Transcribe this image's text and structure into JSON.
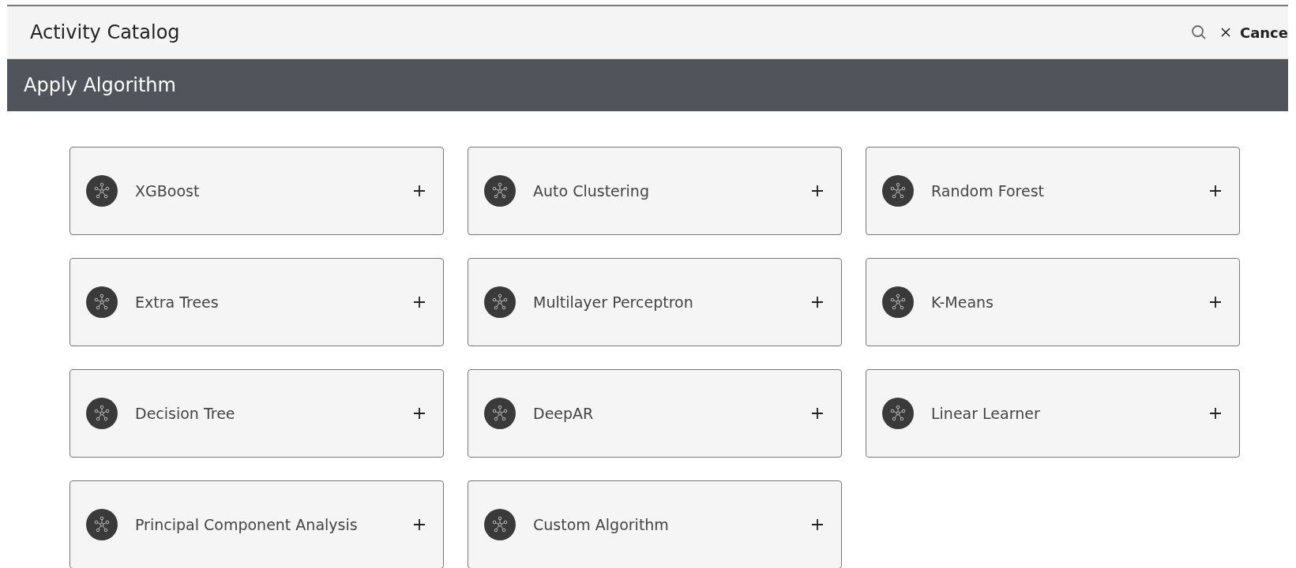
{
  "header": {
    "title": "Activity Catalog",
    "cancel_label": "Cance"
  },
  "section": {
    "title": "Apply Algorithm"
  },
  "cards": [
    {
      "label": "XGBoost"
    },
    {
      "label": "Auto Clustering"
    },
    {
      "label": "Random Forest"
    },
    {
      "label": "Extra Trees"
    },
    {
      "label": "Multilayer Perceptron"
    },
    {
      "label": "K-Means"
    },
    {
      "label": "Decision Tree"
    },
    {
      "label": "DeepAR"
    },
    {
      "label": "Linear Learner"
    },
    {
      "label": "Principal Component Analysis"
    },
    {
      "label": "Custom Algorithm"
    }
  ]
}
